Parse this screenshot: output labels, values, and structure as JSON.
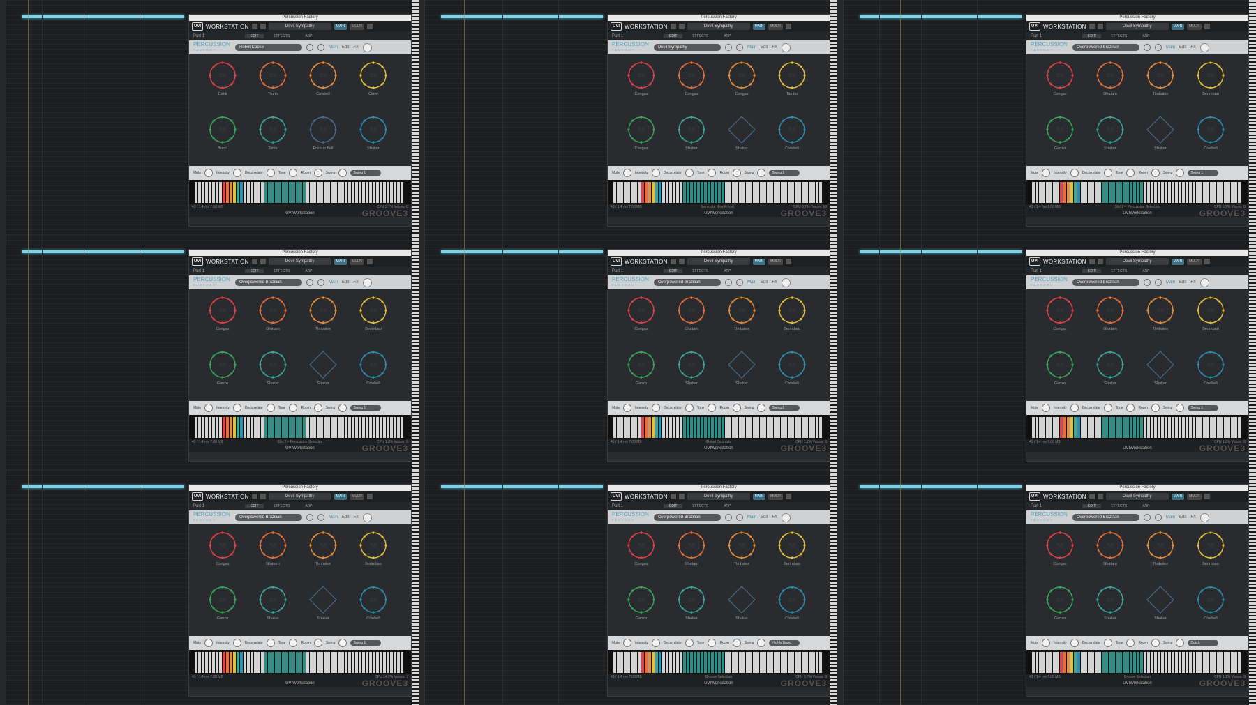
{
  "workstation_label": "WORKSTATION",
  "window_title": "Percussion Factory",
  "part_label": "Part 1",
  "main_btn": "MAIN",
  "multi_btn": "MULTI",
  "tabs": [
    "EDIT",
    "EFFECTS",
    "ARP"
  ],
  "brand_line1": "PERCUSSION",
  "brand_line2": "FACTORY",
  "nav": [
    "Main",
    "Edit",
    "FX"
  ],
  "macro_labels": [
    "Mute",
    "Intensity",
    "Decorrelate",
    "Tone",
    "Room",
    "Swing"
  ],
  "footer_brand": "UVIWorkstation",
  "watermark": "GROOVE3",
  "status_left": "43 / 1.4 ms   7.08 MB",
  "colors": {
    "pad_row1": [
      "#e2434a",
      "#e5713a",
      "#e58f3a",
      "#e3c23a"
    ],
    "pad_row2": [
      "#38a85e",
      "#3aa79a",
      "#4a6a8a",
      "#2b8fb0"
    ],
    "accent": "#7fd3e6"
  },
  "panels": [
    {
      "preset": "Devil Sympathy",
      "kit": "Robot Cookie",
      "labels": [
        "Conk",
        "Trunk",
        "Cowbell",
        "Clave",
        "Brazil",
        "Tabla",
        "Foxbun Bell",
        "Shaker"
      ],
      "status_mid": "",
      "status_right": "CPU 3.7%   Voices: 6"
    },
    {
      "preset": "Devil Sympathy",
      "kit": "Devil Sympathy",
      "labels": [
        "Congas",
        "Congas",
        "Congas",
        "Tambo",
        "Congas",
        "Shaker",
        "Shaker",
        "Cowbell"
      ],
      "status_mid": "Generate New Preset",
      "status_right": "CPU 3.7%   Voices: 10"
    },
    {
      "preset": "Devil Sympathy",
      "kit": "Overpowered Brazilian",
      "labels": [
        "Congas",
        "Ghatam",
        "Timbales",
        "Berimbau",
        "Ganza",
        "Shaker",
        "Shaker",
        "Cowbell"
      ],
      "status_mid": "Slot 2 – Percussion Selection",
      "status_right": "CPU 1.9%   Voices: 6"
    },
    {
      "preset": "Devil Sympathy",
      "kit": "Overpowered Brazilian",
      "labels": [
        "Congas",
        "Ghatam",
        "Timbales",
        "Berimbau",
        "Ganza",
        "Shaker",
        "Shaker",
        "Cowbell"
      ],
      "status_mid": "Slot 2 – Percussion Selection",
      "status_right": "CPU 1.9%   Voices: 6"
    },
    {
      "preset": "Devil Sympathy",
      "kit": "Overpowered Brazilian",
      "labels": [
        "Congas",
        "Ghatam",
        "Timbales",
        "Berimbau",
        "Ganza",
        "Shaker",
        "Shaker",
        "Cowbell"
      ],
      "status_mid": "Global Decimate",
      "status_right": "CPU 1.1%   Voices: 6"
    },
    {
      "preset": "Devil Sympathy",
      "kit": "Overpowered Brazilian",
      "labels": [
        "Congas",
        "Ghatam",
        "Timbales",
        "Berimbau",
        "Ganza",
        "Shaker",
        "Shaker",
        "Cowbell"
      ],
      "status_mid": "",
      "status_right": "CPU 1.9%   Voices: 6"
    },
    {
      "preset": "Devil Sympathy",
      "kit": "Overpowered Brazilian",
      "labels": [
        "Congas",
        "Ghatam",
        "Timbales",
        "Berimbau",
        "Ganza",
        "Shaker",
        "Shaker",
        "Cowbell"
      ],
      "status_mid": "",
      "status_right": "CPU 14.2%   Voices: 7"
    },
    {
      "preset": "Devil Sympathy",
      "kit": "Overpowered Brazilian",
      "labels": [
        "Congas",
        "Ghatam",
        "Timbales",
        "Berimbau",
        "Ganza",
        "Shaker",
        "Shaker",
        "Cowbell"
      ],
      "status_mid": "Groove Selection",
      "status_right": "CPU 3.7%   Voices: 6"
    },
    {
      "preset": "Devil Sympathy",
      "kit": "Overpowered Brazilian",
      "labels": [
        "Congas",
        "Ghatam",
        "Timbales",
        "Berimbau",
        "Ganza",
        "Shaker",
        "Shaker",
        "Cowbell"
      ],
      "status_mid": "Groove Selection",
      "status_right": "CPU 1.1%   Voices: 6"
    }
  ],
  "swing_values": [
    "Swing 1",
    "Swing 1",
    "Swing 1",
    "Swing 1",
    "Swing 1",
    "Swing 1",
    "Swing 1",
    "Highly Basic",
    "Dutch"
  ]
}
